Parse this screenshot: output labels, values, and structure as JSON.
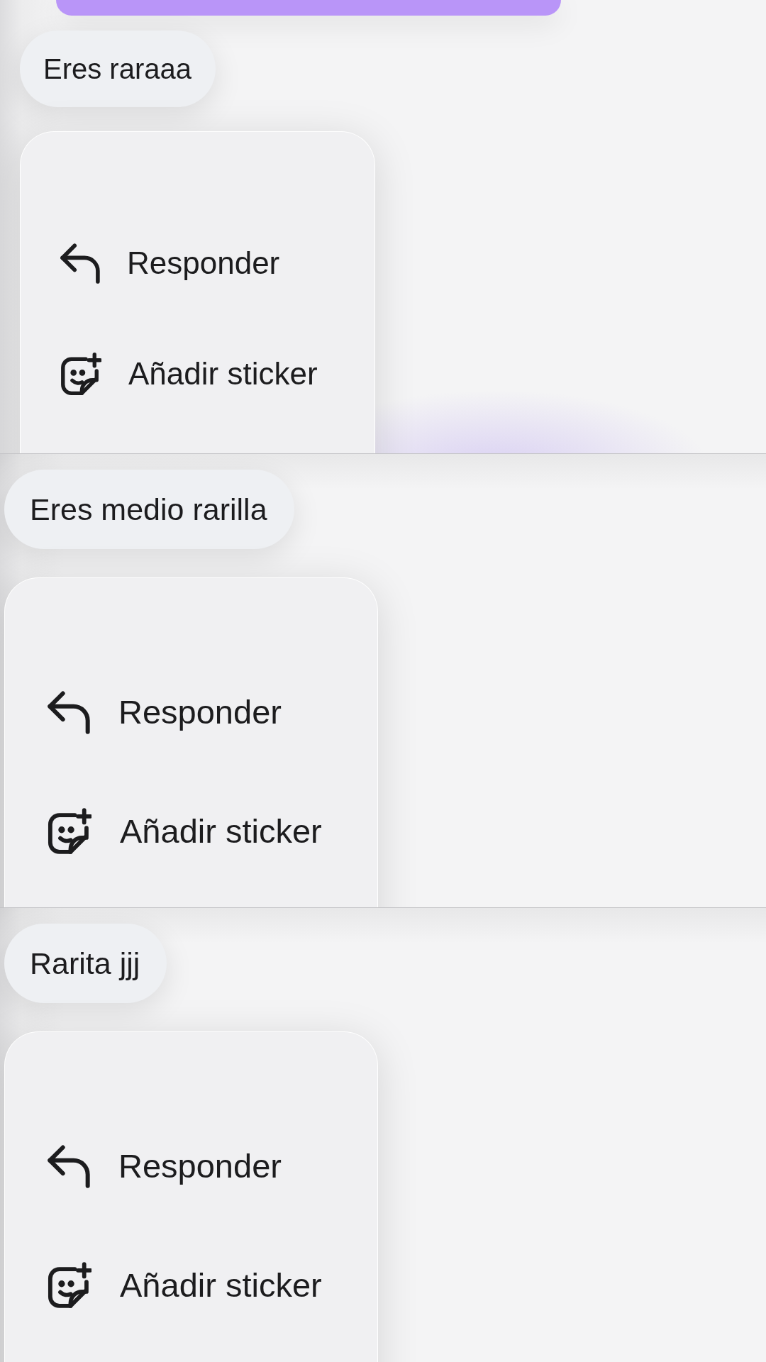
{
  "panels": [
    {
      "sent_bubble_above": true,
      "message": "Eres raraaa",
      "menu": [
        {
          "kind": "reply",
          "label": "Responder"
        },
        {
          "kind": "sticker",
          "label": "Añadir sticker"
        }
      ]
    },
    {
      "sent_bubble_above": false,
      "message": "Eres medio rarilla",
      "menu": [
        {
          "kind": "reply",
          "label": "Responder"
        },
        {
          "kind": "sticker",
          "label": "Añadir sticker"
        }
      ]
    },
    {
      "sent_bubble_above": false,
      "message": "Rarita jjj",
      "menu": [
        {
          "kind": "reply",
          "label": "Responder"
        },
        {
          "kind": "sticker",
          "label": "Añadir sticker"
        }
      ]
    }
  ]
}
